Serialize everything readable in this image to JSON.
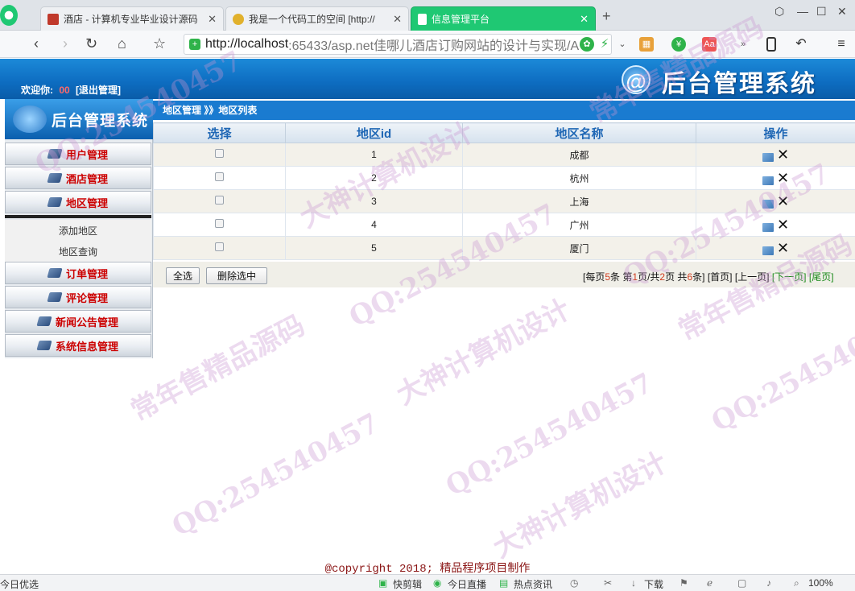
{
  "browser": {
    "tabs": [
      {
        "title": "酒店 - 计算机专业毕业设计源码",
        "favicon_color": "#c0392b",
        "active": false
      },
      {
        "title": "我是一个代码工的空间 [http://",
        "favicon_color": "#e1b12c",
        "active": false
      },
      {
        "title": "信息管理平台",
        "favicon_color": "#ffffff",
        "active": true
      }
    ],
    "url_host": "http://localhost",
    "url_rest": ":65433/asp.net佳哪儿酒店订购网站的设计与实现/A",
    "status_left": "今日优选",
    "status_items": [
      "快剪辑",
      "今日直播",
      "热点资讯",
      "下载",
      "100%"
    ]
  },
  "header": {
    "welcome_label": "欢迎你:",
    "username": "00",
    "logout_label": "[退出管理]",
    "title": "后台管理系统"
  },
  "sidebar": {
    "title": "后台管理系统",
    "menus": [
      {
        "label": "用户管理"
      },
      {
        "label": "酒店管理"
      },
      {
        "label": "地区管理"
      },
      {
        "label": "订单管理"
      },
      {
        "label": "评论管理"
      },
      {
        "label": "新闻公告管理"
      },
      {
        "label": "系统信息管理"
      }
    ],
    "submenu": [
      {
        "label": "添加地区"
      },
      {
        "label": "地区查询"
      }
    ]
  },
  "breadcrumb": "地区管理 》》地区列表",
  "table": {
    "columns": [
      "选择",
      "地区id",
      "地区名称",
      "操作"
    ],
    "rows": [
      {
        "id": "1",
        "name": "成都"
      },
      {
        "id": "2",
        "name": "杭州"
      },
      {
        "id": "3",
        "name": "上海"
      },
      {
        "id": "4",
        "name": "广州"
      },
      {
        "id": "5",
        "name": "厦门"
      }
    ]
  },
  "actions": {
    "select_all": "全选",
    "delete_selected": "删除选中"
  },
  "pager": {
    "prefix": "[每页",
    "per_page": "5",
    "mid1": "条 第",
    "current": "1",
    "mid2": "页/共",
    "pages": "2",
    "mid3": "页 共",
    "total": "6",
    "suffix": "条]",
    "first": "[首页]",
    "prev": "[上一页]",
    "next": "[下一页]",
    "last": "[尾页]"
  },
  "footer": {
    "copyright": "@copyright 2018; 精品程序项目制作"
  },
  "watermark": {
    "lines": [
      "QQ:254540457",
      "大神计算机设计",
      "常年售精品源码"
    ]
  }
}
